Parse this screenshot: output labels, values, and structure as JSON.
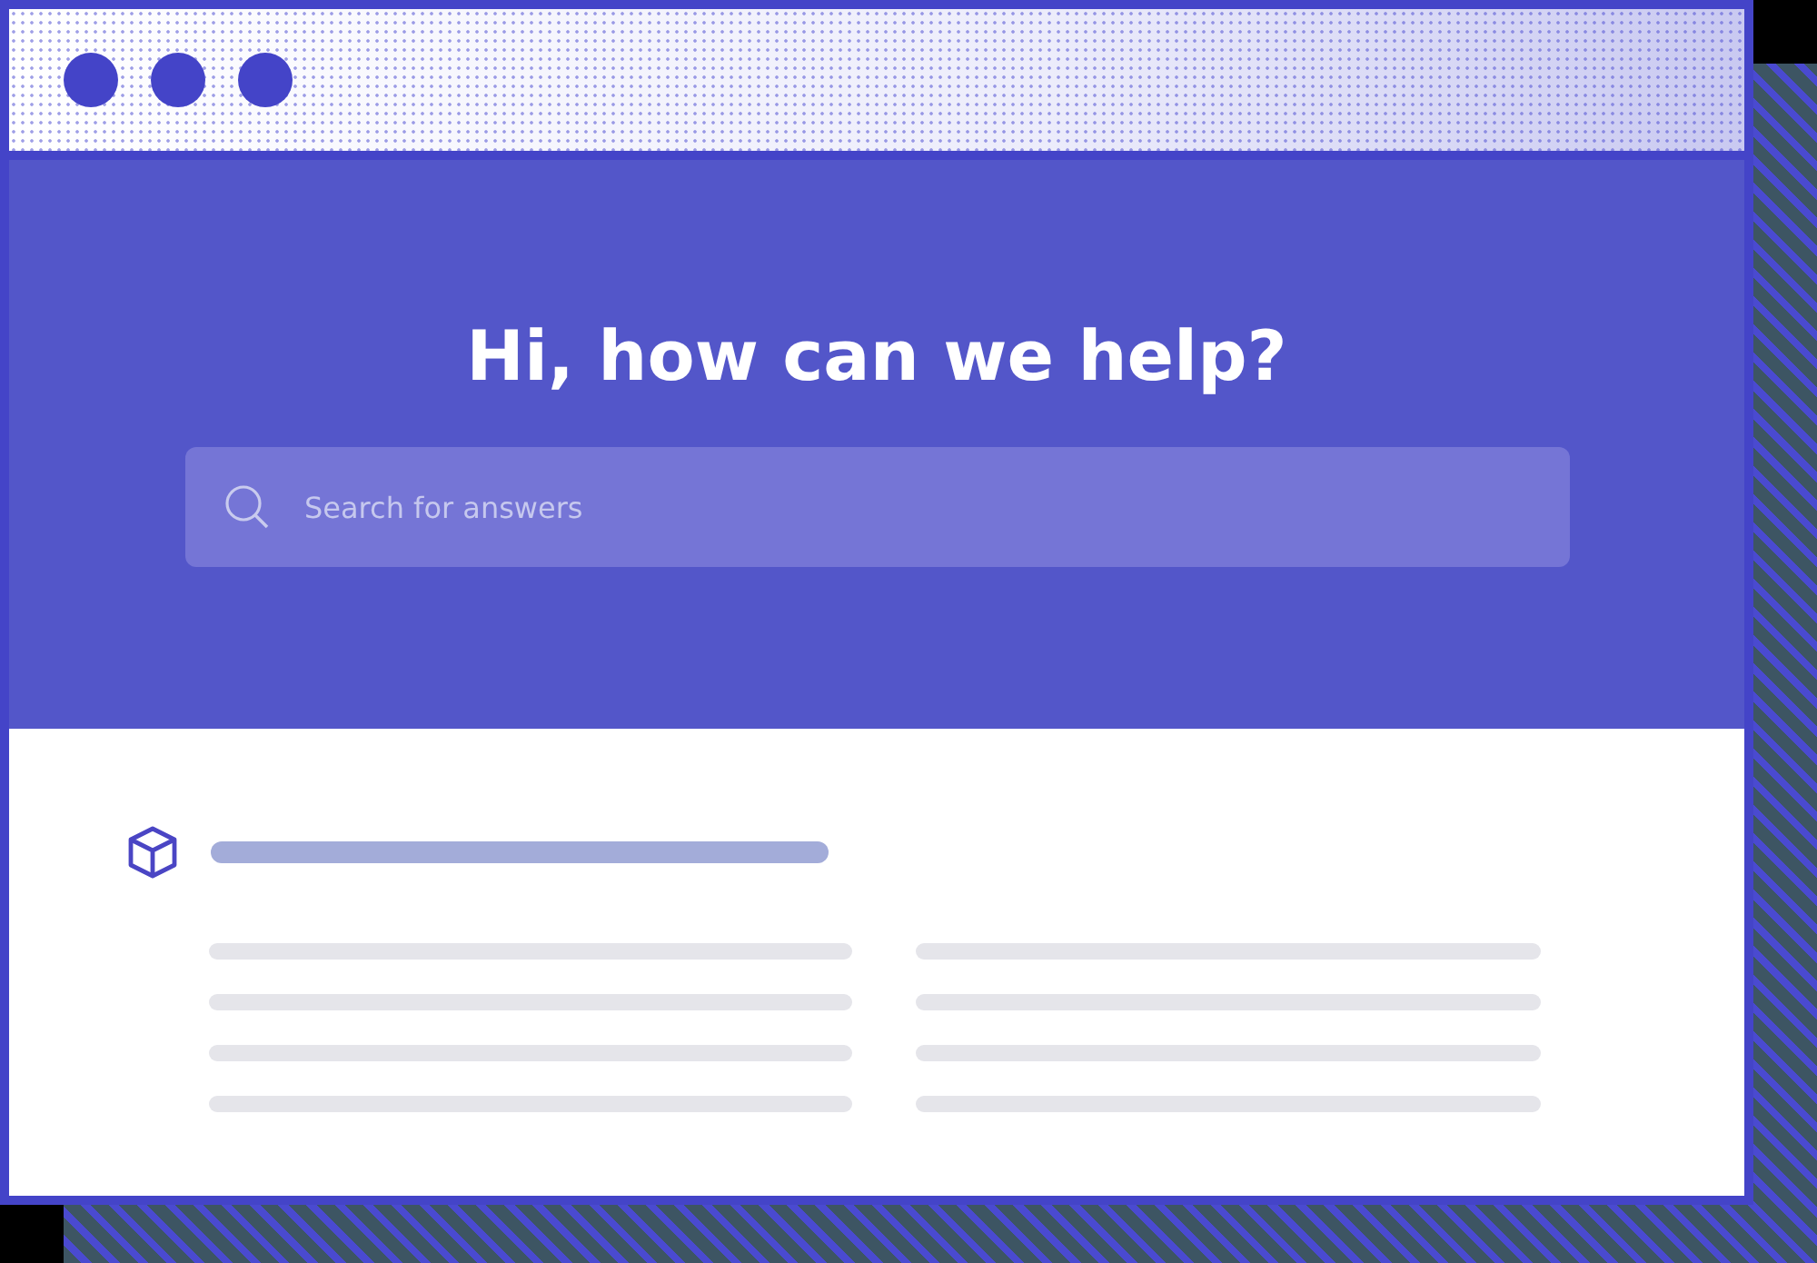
{
  "hero": {
    "title": "Hi, how can we help?"
  },
  "search": {
    "placeholder": "Search for answers"
  }
}
